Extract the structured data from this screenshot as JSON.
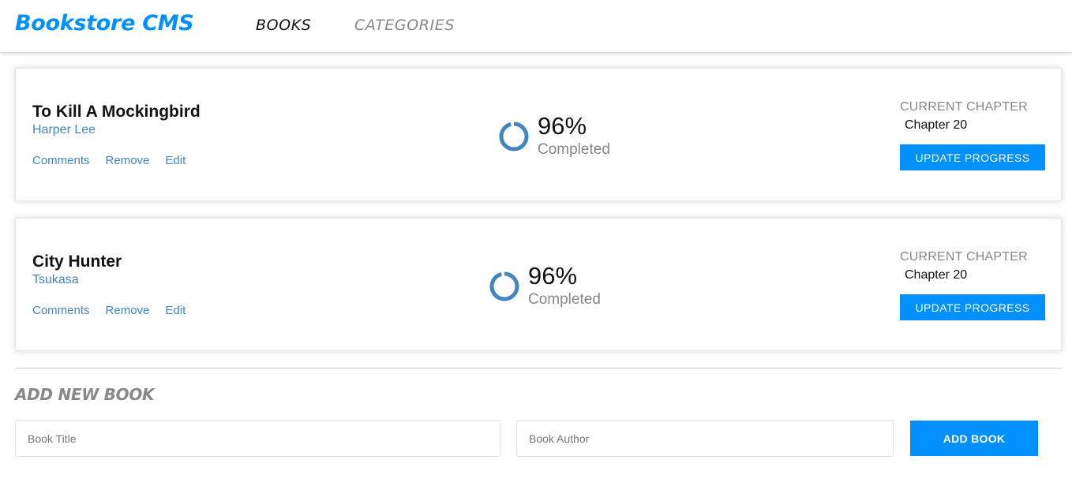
{
  "header": {
    "logo": "Bookstore CMS",
    "nav": [
      {
        "label": "BOOKS"
      },
      {
        "label": "CATEGORIES"
      }
    ]
  },
  "books": [
    {
      "title": "To Kill A Mockingbird",
      "author": "Harper Lee",
      "actions": [
        "Comments",
        "Remove",
        "Edit"
      ],
      "progress_percent": 96,
      "progress_label": "96%",
      "completed_label": "Completed",
      "chapter_label": "CURRENT CHAPTER",
      "chapter": "Chapter 20",
      "update_label": "UPDATE PROGRESS"
    },
    {
      "title": "City Hunter",
      "author": "Tsukasa",
      "actions": [
        "Comments",
        "Remove",
        "Edit"
      ],
      "progress_percent": 96,
      "progress_label": "96%",
      "completed_label": "Completed",
      "chapter_label": "CURRENT CHAPTER",
      "chapter": "Chapter 20",
      "update_label": "UPDATE PROGRESS"
    }
  ],
  "form": {
    "title": "ADD NEW BOOK",
    "title_placeholder": "Book Title",
    "author_placeholder": "Book Author",
    "submit_label": "ADD BOOK"
  },
  "colors": {
    "accent": "#0290ff",
    "link": "#4386bf",
    "ring": "#4386bf",
    "muted": "#888888"
  }
}
